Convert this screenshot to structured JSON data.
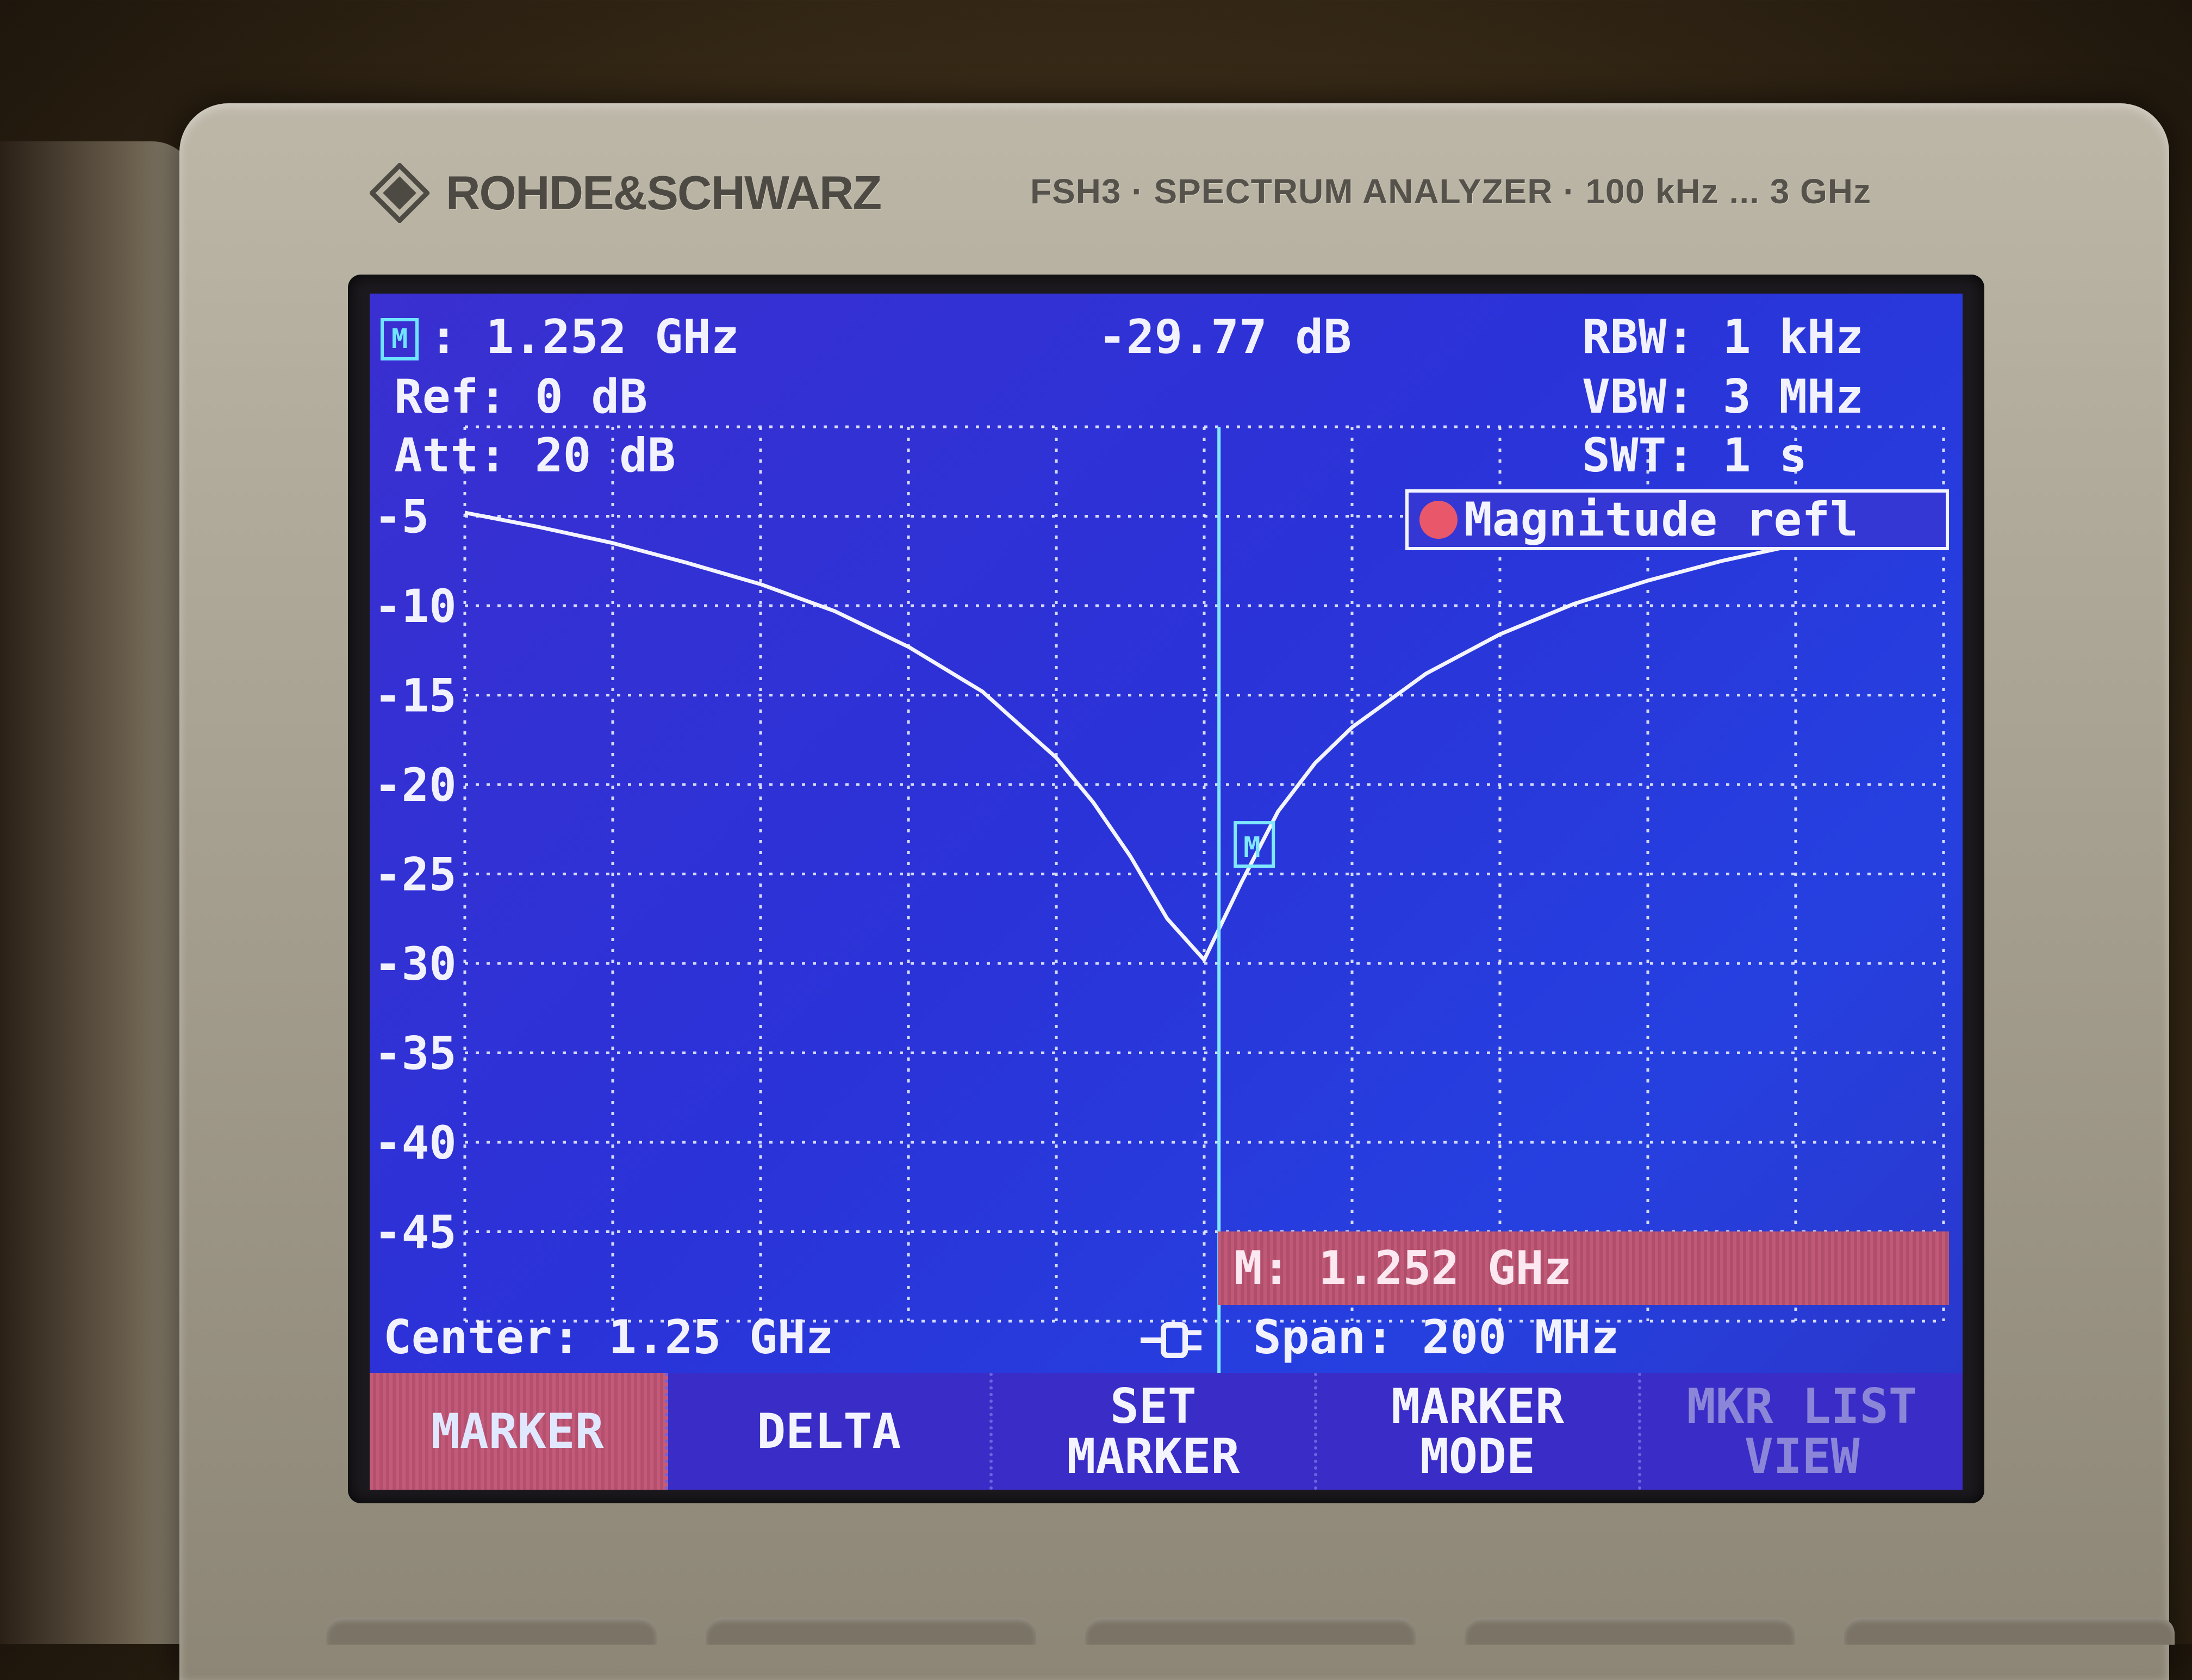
{
  "device": {
    "brand": "ROHDE&SCHWARZ",
    "model": "FSH3 · SPECTRUM ANALYZER · 100 kHz ... 3 GHz"
  },
  "status": {
    "marker_icon": "marker-m-icon",
    "marker_freq": ": 1.252 GHz",
    "marker_level": "-29.77 dB",
    "ref": "Ref: 0 dB",
    "att": "Att: 20 dB",
    "rbw": "RBW: 1 kHz",
    "vbw": "VBW: 3 MHz",
    "swt": "SWT: 1 s"
  },
  "legend": {
    "label": "Magnitude refl",
    "color": "#e8586a"
  },
  "chart_data": {
    "type": "line",
    "title": "",
    "xlabel": "",
    "ylabel": "",
    "x_unit": "GHz",
    "y_unit": "dB",
    "xlim": [
      1.15,
      1.35
    ],
    "ylim": [
      -50,
      0
    ],
    "grid": true,
    "yticks": [
      -5,
      -10,
      -15,
      -20,
      -25,
      -30,
      -35,
      -40,
      -45
    ],
    "series": [
      {
        "name": "Magnitude refl",
        "color": "#f4f4ff",
        "x": [
          1.15,
          1.16,
          1.17,
          1.18,
          1.19,
          1.2,
          1.21,
          1.22,
          1.23,
          1.235,
          1.24,
          1.245,
          1.25,
          1.255,
          1.26,
          1.265,
          1.27,
          1.28,
          1.29,
          1.3,
          1.31,
          1.32,
          1.33,
          1.34,
          1.35
        ],
        "y": [
          -4.8,
          -5.6,
          -6.5,
          -7.6,
          -8.8,
          -10.3,
          -12.3,
          -14.8,
          -18.5,
          -21.0,
          -24.0,
          -27.5,
          -29.8,
          -25.5,
          -21.5,
          -18.8,
          -16.8,
          -13.8,
          -11.6,
          -9.9,
          -8.6,
          -7.5,
          -6.6,
          -5.9,
          -5.3
        ]
      }
    ],
    "marker": {
      "x": 1.252,
      "y": -29.77,
      "label": "M: 1.252 GHz"
    }
  },
  "footer": {
    "center": "Center: 1.25 GHz",
    "span_icon": "plug-icon",
    "span": "Span: 200 MHz"
  },
  "softkeys": [
    {
      "label": "MARKER"
    },
    {
      "label": "DELTA"
    },
    {
      "label": "SET\nMARKER"
    },
    {
      "label": "MARKER\nMODE"
    },
    {
      "label": "MKR LIST\nVIEW"
    }
  ],
  "colors": {
    "screen_bg": "#2a33d8",
    "trace": "#f4f4ff",
    "marker_line": "#7fe8ff",
    "highlight": "#c05a78"
  }
}
